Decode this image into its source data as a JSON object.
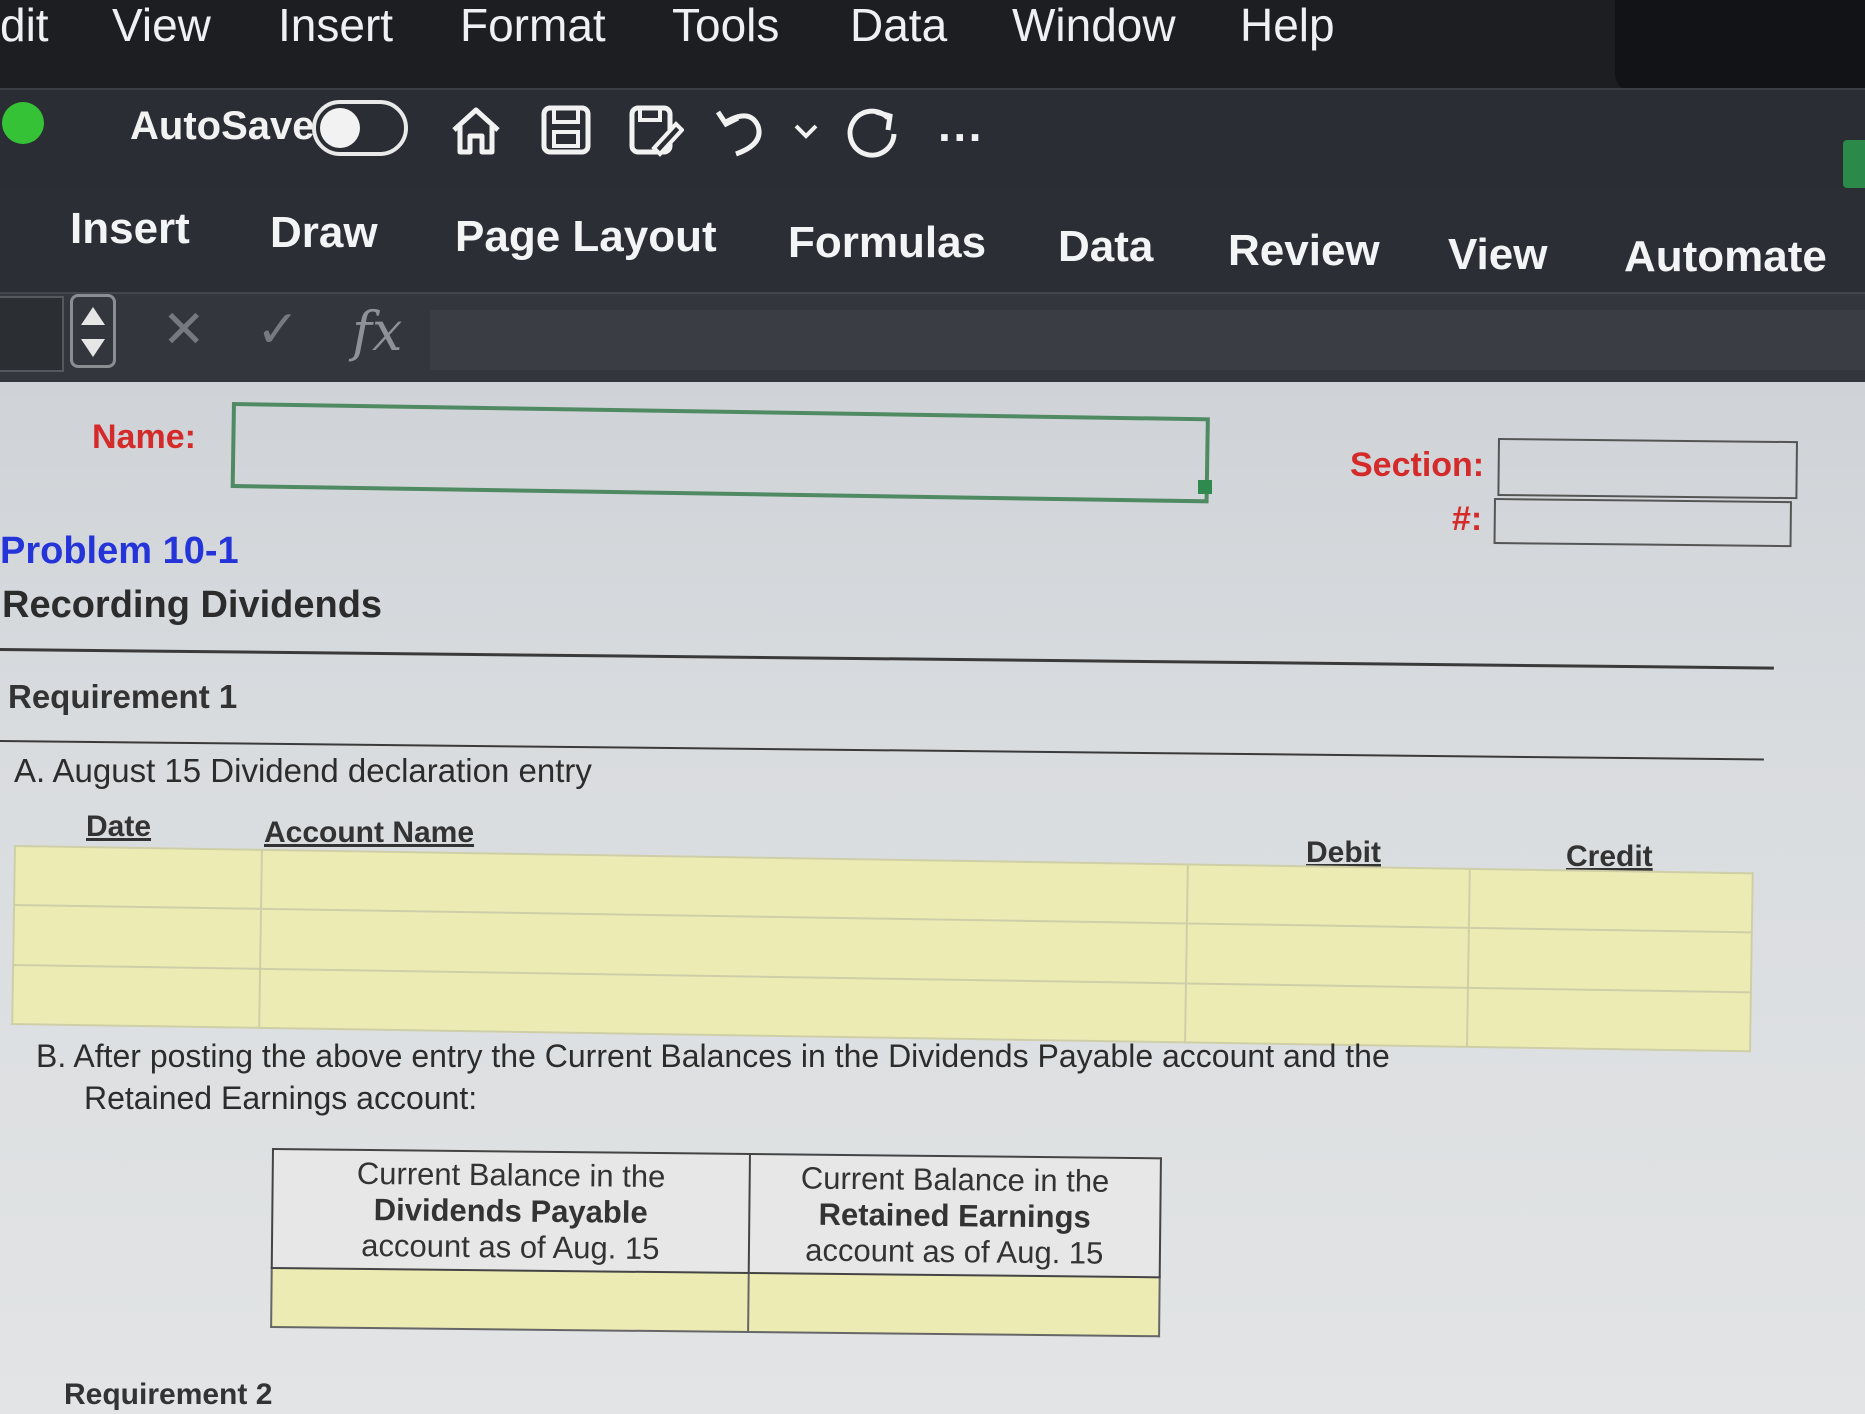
{
  "menubar": {
    "items": [
      "dit",
      "View",
      "Insert",
      "Format",
      "Tools",
      "Data",
      "Window",
      "Help"
    ]
  },
  "toolbar": {
    "autosave_label": "AutoSave",
    "more_label": "···",
    "icons": [
      "home-icon",
      "save-icon",
      "save-as-icon",
      "undo-icon",
      "chevron-down-icon",
      "redo-icon",
      "more-icon"
    ]
  },
  "ribbon": {
    "tabs": [
      "Insert",
      "Draw",
      "Page Layout",
      "Formulas",
      "Data",
      "Review",
      "View",
      "Automate"
    ]
  },
  "formula_bar": {
    "cancel_glyph": "✕",
    "enter_glyph": "✓",
    "fx_label": "fx",
    "value": ""
  },
  "sheet": {
    "name_label": "Name:",
    "section_label": "Section:",
    "hash_label": "#:",
    "problem": "Problem 10-1",
    "subtitle": "Recording Dividends",
    "requirement1": "Requirement 1",
    "partA": "A.  August 15 Dividend declaration entry",
    "journal_headers": {
      "date": "Date",
      "account": "Account Name",
      "debit": "Debit",
      "credit": "Credit"
    },
    "partB_line1": "B.  After posting the above entry the Current Balances in the Dividends Payable account and the",
    "partB_line2": "Retained Earnings account:",
    "balances": {
      "col1": {
        "line1": "Current Balance in the",
        "line2": "Dividends Payable",
        "line3": "account as of Aug. 15"
      },
      "col2": {
        "line1": "Current Balance in the",
        "line2": "Retained Earnings",
        "line3": "account as of Aug. 15"
      }
    },
    "requirement2": "Requirement 2"
  },
  "colors": {
    "input_fill": "#ecebb4",
    "problem_blue": "#2434d8",
    "label_red": "#d42a2a",
    "autosave_green": "#36c237"
  }
}
